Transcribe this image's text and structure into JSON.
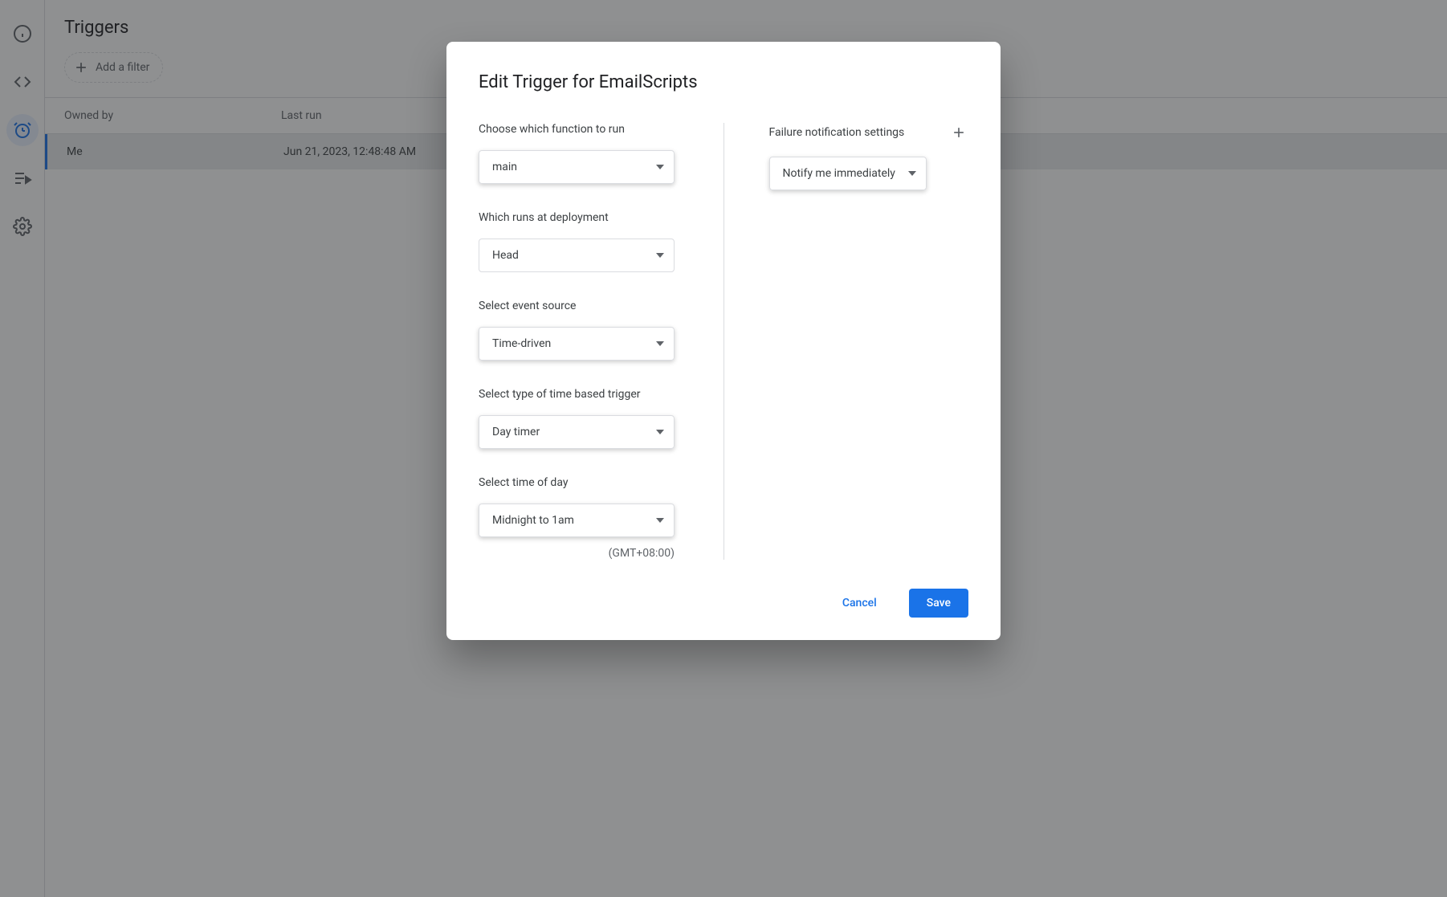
{
  "page": {
    "title": "Triggers",
    "filter_label": "Add a filter"
  },
  "table": {
    "columns": {
      "owned_by": "Owned by",
      "last_run": "Last run"
    },
    "rows": [
      {
        "owned_by": "Me",
        "last_run": "Jun 21, 2023, 12:48:48 AM"
      }
    ]
  },
  "modal": {
    "title": "Edit Trigger for EmailScripts",
    "function_label": "Choose which function to run",
    "function_value": "main",
    "deployment_label": "Which runs at deployment",
    "deployment_value": "Head",
    "event_source_label": "Select event source",
    "event_source_value": "Time-driven",
    "time_trigger_type_label": "Select type of time based trigger",
    "time_trigger_type_value": "Day timer",
    "time_of_day_label": "Select time of day",
    "time_of_day_value": "Midnight to 1am",
    "timezone_note": "(GMT+08:00)",
    "notification_label": "Failure notification settings",
    "notification_value": "Notify me immediately",
    "cancel_label": "Cancel",
    "save_label": "Save"
  }
}
